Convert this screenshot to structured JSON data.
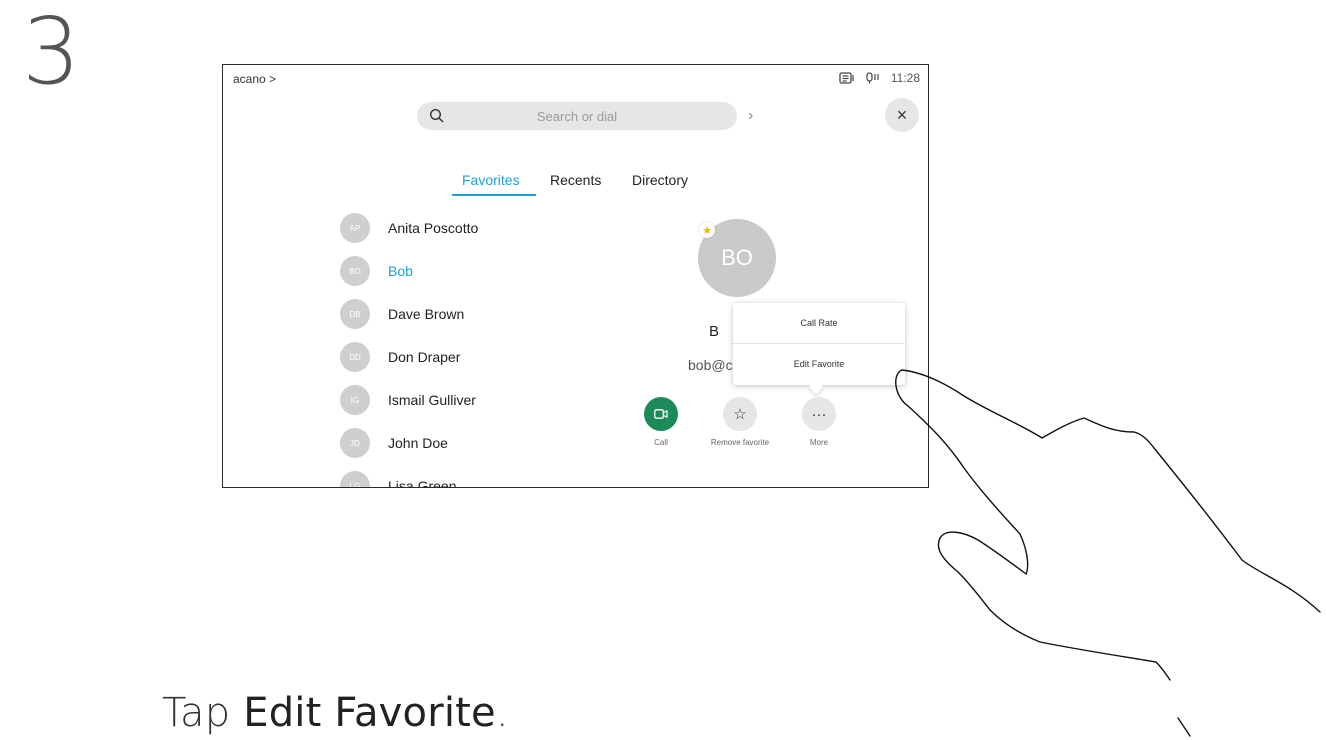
{
  "step": "3",
  "screen": {
    "breadcrumb": "acano >",
    "time": "11:28",
    "search": {
      "placeholder": "Search or dial"
    },
    "tabs": [
      {
        "label": "Favorites",
        "active": true
      },
      {
        "label": "Recents",
        "active": false
      },
      {
        "label": "Directory",
        "active": false
      }
    ],
    "contacts": [
      {
        "initials": "AP",
        "name": "Anita Poscotto",
        "selected": false
      },
      {
        "initials": "BO",
        "name": "Bob",
        "selected": true
      },
      {
        "initials": "DB",
        "name": "Dave Brown",
        "selected": false
      },
      {
        "initials": "DD",
        "name": "Don Draper",
        "selected": false
      },
      {
        "initials": "IG",
        "name": "Ismail Gulliver",
        "selected": false
      },
      {
        "initials": "JD",
        "name": "John Doe",
        "selected": false
      },
      {
        "initials": "LG",
        "name": "Lisa Green",
        "selected": false
      }
    ],
    "detail": {
      "initials": "BO",
      "name_visible": "B",
      "email_visible": "bob@c",
      "actions": [
        {
          "icon": "video-icon",
          "label": "Call"
        },
        {
          "icon": "star-icon",
          "label": "Remove favorite"
        },
        {
          "icon": "more-icon",
          "label": "More"
        }
      ]
    },
    "more_menu": {
      "items": [
        "Call Rate",
        "Edit Favorite"
      ]
    },
    "colors": {
      "accent": "#1ba0d7",
      "call_green": "#1d8a5a",
      "favorite_star": "#f0b400"
    }
  },
  "instruction": {
    "prefix": "Tap ",
    "emphasis": "Edit Favorite",
    "suffix": "."
  }
}
